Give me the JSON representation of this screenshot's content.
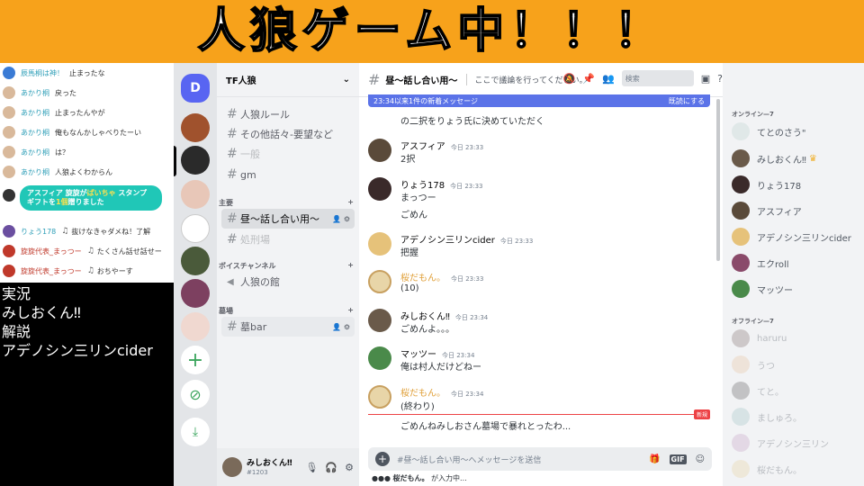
{
  "banner": {
    "title": "人狼ゲーム中！！！"
  },
  "live_chat": {
    "messages": [
      {
        "name": "辰馬桐は神！",
        "text": "止まったな"
      },
      {
        "name": "あかり桐",
        "text": "戻った"
      },
      {
        "name": "あかり桐",
        "text": "止まったんやが"
      },
      {
        "name": "あかり桐",
        "text": "俺もなんかしゃべりたーい"
      },
      {
        "name": "あかり桐",
        "text": "は？"
      },
      {
        "name": "あかり桐",
        "text": "人狼よくわからん"
      },
      {
        "name": "りょう178",
        "text": "抜けなきゃダメね！了解"
      },
      {
        "name": "旋旋代表_まっつー",
        "text": "たくさん話せ話せー"
      },
      {
        "name": "旋旋代表_まっつー",
        "text": "おちやーす"
      }
    ],
    "super_chat": {
      "line1a": "アスフィア 旋旋が",
      "line1b": "ぱいちゃ",
      "line1c": "スタンプ",
      "line2a": "ギフトを",
      "line2b": "1個",
      "line2c": "贈りました"
    }
  },
  "caption": {
    "line1": "実況",
    "line2": "みしおくん‼",
    "line3": "解説",
    "line4": "アデノシン三リンcider"
  },
  "rail": {
    "home_label": "D",
    "add_label": "+",
    "explore_label": "⊘",
    "download_label": "⤓"
  },
  "channels": {
    "server_name": "TF人狼",
    "items": [
      {
        "label": "人狼ルール"
      },
      {
        "label": "その他話々-要望など"
      },
      {
        "label": "一般"
      },
      {
        "label": "gm"
      }
    ],
    "cat_main": "主要",
    "main_items": [
      {
        "label": "昼〜話し合い用〜"
      },
      {
        "label": "処刑場"
      }
    ],
    "cat_voice": "ボイスチャンネル",
    "voice_items": [
      {
        "label": "人狼の館"
      }
    ],
    "cat_grave": "墓場",
    "grave_items": [
      {
        "label": "墓bar"
      }
    ]
  },
  "user": {
    "name": "みしおくん‼",
    "tag": "#1203"
  },
  "chat": {
    "channel_title": "昼〜話し合い用〜",
    "topic": "ここで議論を行ってください。",
    "search_placeholder": "検索",
    "new_bar_left": "23:34以来1件の新着メッセージ",
    "new_bar_right": "既読にする",
    "cut_text": "の二択をりょう氏に決めていただく",
    "messages": [
      {
        "name": "アスフィア",
        "time": "今日 23:33",
        "text": "2択"
      },
      {
        "name": "りょう178",
        "time": "今日 23:33",
        "text": "まっつー",
        "text2": "ごめん"
      },
      {
        "name": "アデノシン三リンcider",
        "time": "今日 23:33",
        "text": "把握"
      },
      {
        "name": "桜だもん。",
        "time": "今日 23:33",
        "text": "(10)"
      },
      {
        "name": "みしおくん‼",
        "time": "今日 23:34",
        "text": "ごめんよ。。。"
      },
      {
        "name": "マッツー",
        "time": "今日 23:34",
        "text": "俺は村人だけどねー"
      },
      {
        "name": "桜だもん。",
        "time": "今日 23:34",
        "text": "(終わり)"
      }
    ],
    "new_text": "ごめんねみしおさん墓場で暴れとったわ...",
    "new_tag": "新規",
    "input_placeholder": "#昼〜話し合い用〜へメッセージを送信",
    "typing_name": "桜だもん。",
    "typing_suffix": "が入力中..."
  },
  "members": {
    "online_header": "オンライン—7",
    "online": [
      {
        "name": "てとのさう\""
      },
      {
        "name": "みしおくん‼"
      },
      {
        "name": "りょう178"
      },
      {
        "name": "アスフィア"
      },
      {
        "name": "アデノシン三リンcider"
      },
      {
        "name": "エクroll"
      },
      {
        "name": "マッツー"
      }
    ],
    "offline_header": "オフライン—7",
    "offline": [
      {
        "name": "haruru"
      },
      {
        "name": "うつ"
      },
      {
        "name": "てと。"
      },
      {
        "name": "ましゅろ。"
      },
      {
        "name": "アデノシン三リン"
      },
      {
        "name": "桜だもん。"
      }
    ]
  }
}
